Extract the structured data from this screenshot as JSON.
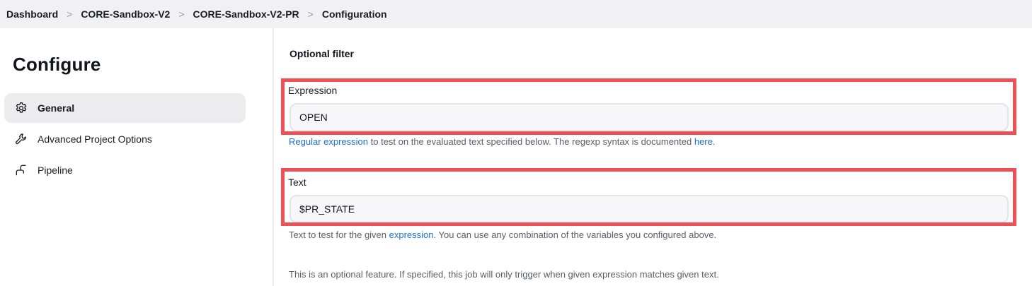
{
  "breadcrumb": {
    "items": [
      "Dashboard",
      "CORE-Sandbox-V2",
      "CORE-Sandbox-V2-PR",
      "Configuration"
    ],
    "separator": ">"
  },
  "sidebar": {
    "title": "Configure",
    "items": [
      {
        "label": "General",
        "icon": "gear-icon",
        "active": true
      },
      {
        "label": "Advanced Project Options",
        "icon": "wrench-icon",
        "active": false
      },
      {
        "label": "Pipeline",
        "icon": "pipeline-icon",
        "active": false
      }
    ]
  },
  "main": {
    "section_title": "Optional filter",
    "expression": {
      "label": "Expression",
      "value": "OPEN",
      "help_link": "Regular expression",
      "help_text": " to test on the evaluated text specified below. The regexp syntax is documented ",
      "help_link2": "here",
      "help_end": "."
    },
    "text": {
      "label": "Text",
      "value": "$PR_STATE",
      "help_start": "Text to test for the given ",
      "help_link": "expression",
      "help_end": ". You can use any combination of the variables you configured above."
    },
    "note": "This is an optional feature. If specified, this job will only trigger when given expression matches given text."
  },
  "colors": {
    "highlight": "#f04f56",
    "link": "#1c6fd1",
    "topbar_bg": "#f1f1f3",
    "active_item_bg": "#ececef"
  }
}
